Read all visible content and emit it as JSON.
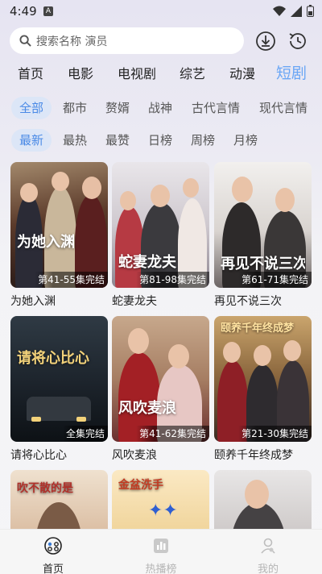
{
  "status": {
    "time": "4:49",
    "badge": "A"
  },
  "search": {
    "placeholder": "搜索名称 演员"
  },
  "main_tabs": [
    "首页",
    "电影",
    "电视剧",
    "综艺",
    "动漫",
    "短剧"
  ],
  "active_main_tab": 5,
  "genre_filters": [
    "全部",
    "都市",
    "赘婿",
    "战神",
    "古代言情",
    "现代言情"
  ],
  "sort_filters": [
    "最新",
    "最热",
    "最赞",
    "日榜",
    "周榜",
    "月榜"
  ],
  "colors": {
    "accent": "#6aa6f5",
    "chip_bg": "#dce6f7"
  },
  "cards": [
    {
      "title": "为她入渊",
      "episodes": "第41-55集完结",
      "overlay": "为她入渊"
    },
    {
      "title": "蛇妻龙夫",
      "episodes": "第81-98集完结",
      "overlay": "蛇妻龙夫"
    },
    {
      "title": "再见不说三次",
      "episodes": "第61-71集完结",
      "overlay": "再见不说三次"
    },
    {
      "title": "请将心比心",
      "episodes": "全集完结",
      "overlay": "请将心比心"
    },
    {
      "title": "风吹麦浪",
      "episodes": "第41-62集完结",
      "overlay": "风吹麦浪"
    },
    {
      "title": "颐养千年终成梦",
      "episodes": "第21-30集完结",
      "overlay": "颐养千年终成梦"
    },
    {
      "title": "",
      "episodes": "",
      "overlay": "吹不散的是"
    },
    {
      "title": "",
      "episodes": "",
      "overlay": "金盆洗手"
    },
    {
      "title": "",
      "episodes": "",
      "overlay": ""
    }
  ],
  "bottom_nav": [
    {
      "label": "首页",
      "icon": "home-icon",
      "active": true
    },
    {
      "label": "热播榜",
      "icon": "chart-icon",
      "active": false
    },
    {
      "label": "我的",
      "icon": "profile-icon",
      "active": false
    }
  ]
}
